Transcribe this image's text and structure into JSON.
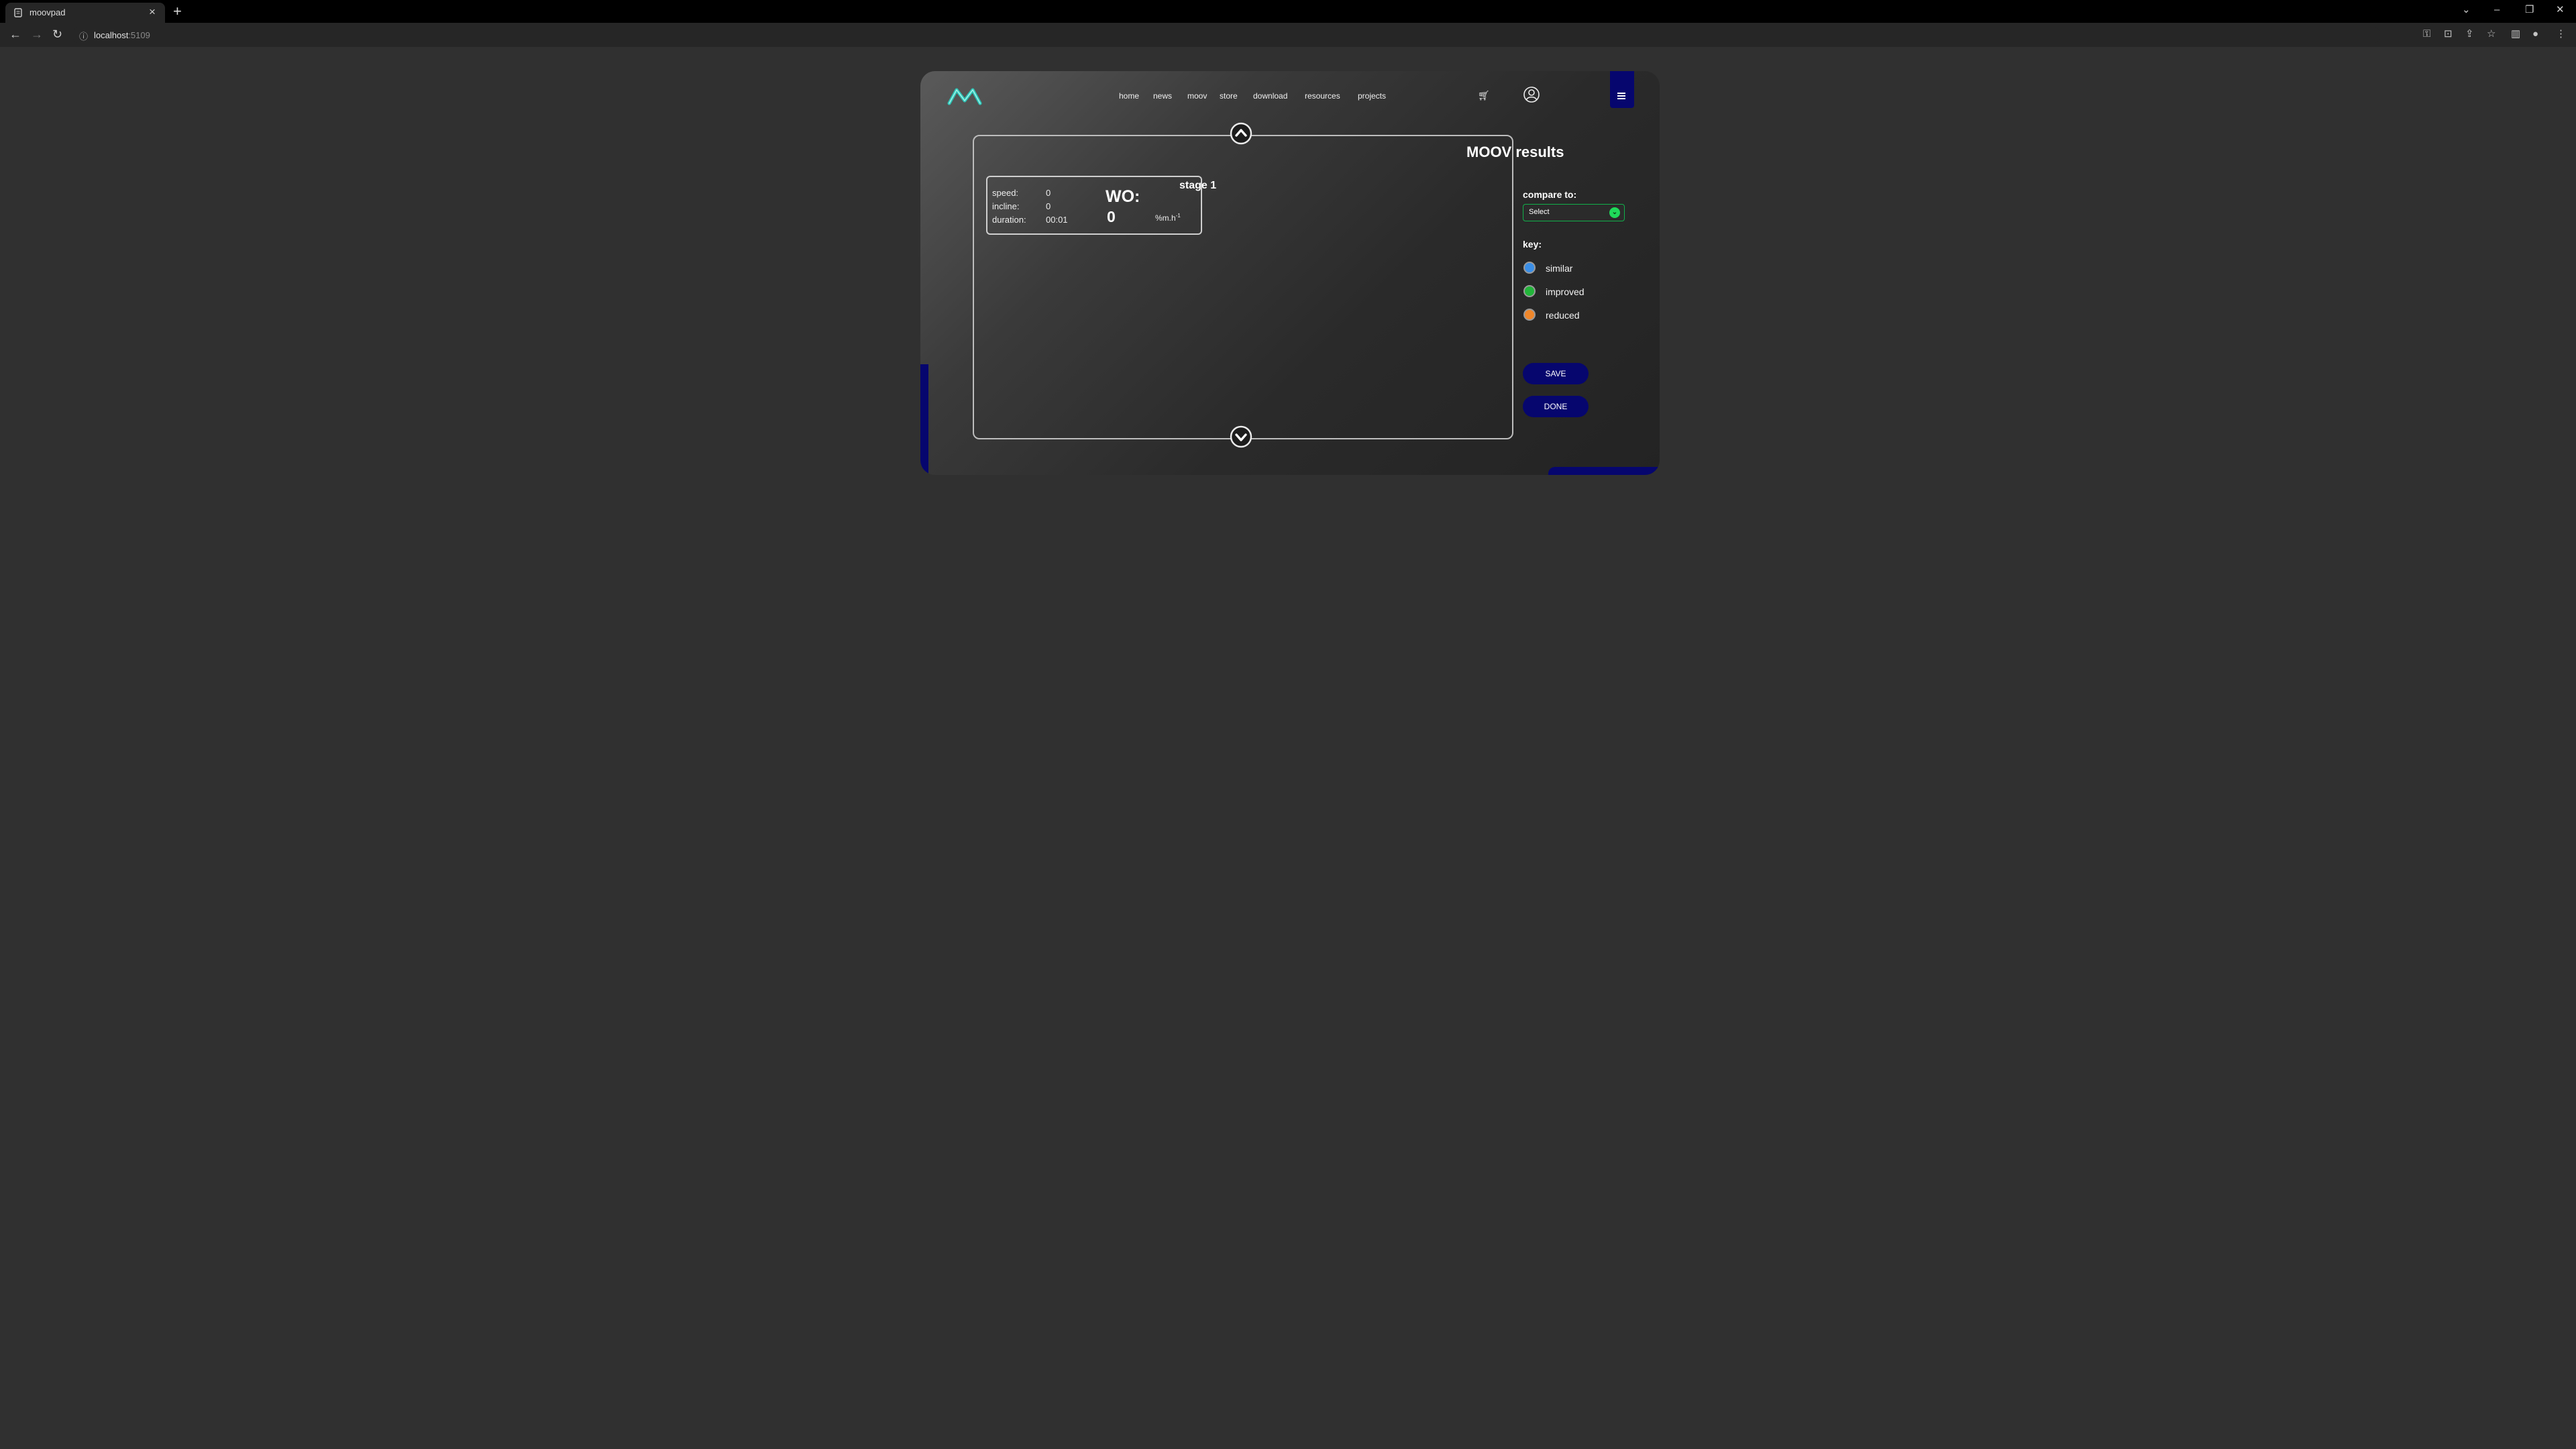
{
  "browser": {
    "tab_title": "moovpad",
    "tab_close": "×",
    "new_tab": "+",
    "url_host": "localhost",
    "url_port": ":5109",
    "back": "←",
    "forward": "→",
    "reload": "↻",
    "window_controls": [
      "⌄",
      "–",
      "❐",
      "✕"
    ]
  },
  "nav": {
    "items": [
      {
        "label": "home"
      },
      {
        "label": "news"
      },
      {
        "label": "moov"
      },
      {
        "label": "store"
      },
      {
        "label": "download"
      },
      {
        "label": "resources"
      },
      {
        "label": "projects"
      }
    ],
    "cart_icon": "cart-icon",
    "user_icon": "user-icon",
    "menu_icon": "hamburger-icon"
  },
  "stage": {
    "title": "stage 1",
    "speed_label": "speed:",
    "speed_value": "0",
    "incline_label": "incline:",
    "incline_value": "0",
    "duration_label": "duration:",
    "duration_value": "00:01",
    "wo_label": "WO:",
    "wo_value": "0",
    "wo_unit": "%m.h",
    "wo_unit_sup": "-1"
  },
  "panel": {
    "title": "MOOV results",
    "compare_label": "compare to:",
    "compare_value": "Select",
    "key_label": "key:",
    "key_items": [
      {
        "label": "similar",
        "color": "#3a8ee6"
      },
      {
        "label": "improved",
        "color": "#22b53a"
      },
      {
        "label": "reduced",
        "color": "#f0872a"
      }
    ],
    "save_label": "SAVE",
    "done_label": "DONE"
  },
  "colors": {
    "accent_navy": "#06066e",
    "logo_teal": "#2ec4b6",
    "select_green": "#1fd95a"
  }
}
